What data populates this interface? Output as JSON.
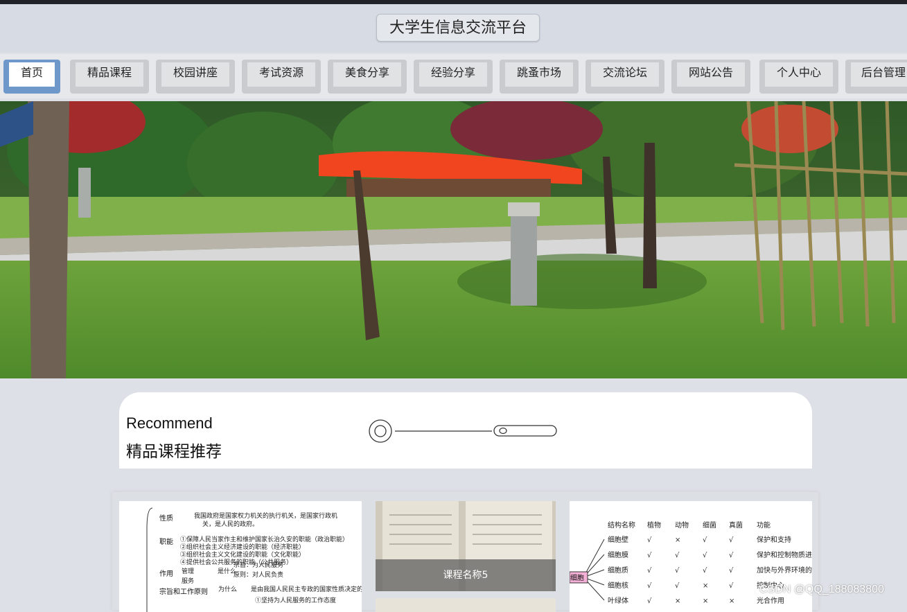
{
  "site": {
    "title": "大学生信息交流平台"
  },
  "nav": {
    "items": [
      "首页",
      "精品课程",
      "校园讲座",
      "考试资源",
      "美食分享",
      "经验分享",
      "跳蚤市场",
      "交流论坛",
      "网站公告",
      "个人中心",
      "后台管理"
    ],
    "active_index": 0
  },
  "banner": {
    "slide_count": 3,
    "active_slide": 0
  },
  "recommend": {
    "title_en": "Recommend",
    "title_cn": "精品课程推荐"
  },
  "courses": {
    "card1": {
      "rows": [
        {
          "label": "性质",
          "lines": [
            "我国政府是国家权力机关的执行机关，是国家行政机",
            "关，是人民的政府。"
          ]
        },
        {
          "label": "职能",
          "lines": [
            "①保障人民当家作主和维护国家长治久安的职能（政治职能）",
            "②组织社会主义经济建设的职能（经济职能）",
            "③组织社会主义文化建设的职能（文化职能）",
            "④提供社会公共服务的职能（公共服务）"
          ]
        },
        {
          "label": "作用",
          "lines": [
            "管理",
            "服务"
          ]
        },
        {
          "label": "宗旨和工作原则",
          "lines": [
            "为什么",
            "是由我国人民民主专政的国家性质决定的",
            "①坚持为人民服务的工作态度"
          ]
        }
      ],
      "extra": [
        "是什么",
        "宗旨：为人民服务",
        "原则：对人民负责"
      ]
    },
    "card2": {
      "caption": "课程名称5"
    },
    "card3": {
      "header": [
        "结构名称",
        "植物",
        "动物",
        "细菌",
        "真菌",
        "功能"
      ],
      "rows": [
        [
          "细胞壁",
          "√",
          "×",
          "√",
          "√",
          "保护和支持"
        ],
        [
          "细胞膜",
          "√",
          "√",
          "√",
          "√",
          "保护和控制物质进出"
        ],
        [
          "细胞质",
          "√",
          "√",
          "√",
          "√",
          "加快与外界环境的物质交流"
        ],
        [
          "细胞核",
          "√",
          "√",
          "×",
          "√",
          "控制中心"
        ],
        [
          "叶绿体",
          "√",
          "×",
          "×",
          "×",
          "光合作用"
        ]
      ],
      "root": "细胞"
    }
  },
  "watermark": "CSDN @QQ_188083800"
}
